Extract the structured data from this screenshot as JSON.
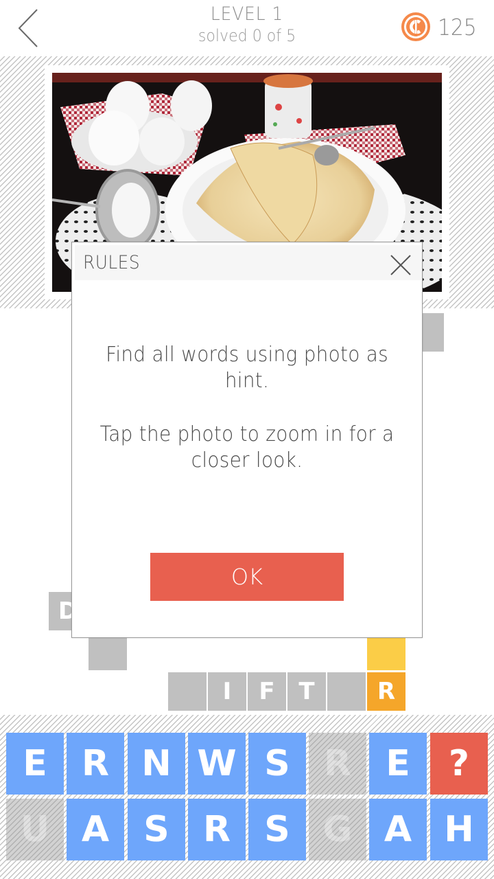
{
  "header": {
    "back_icon": "chevron-left-icon",
    "level_title": "LEVEL 1",
    "progress_text": "solved 0 of 5",
    "coin_icon": "coin-icon",
    "coin_count": "125",
    "colors": {
      "coin": "#f5894a",
      "text": "#8a8a8a"
    }
  },
  "photo": {
    "description": "Crepes on a white plate with fork and spoon, a bowl of eggs on a red checkered napkin, a sieve with powdered sugar, lace doilies, small floral cup"
  },
  "grid": {
    "cells": [
      {
        "id": "c1",
        "letter": "",
        "state": "empty"
      },
      {
        "id": "c2",
        "letter": "D",
        "state": "revealed"
      },
      {
        "id": "c3",
        "letter": "",
        "state": "empty"
      },
      {
        "id": "c4",
        "letter": "",
        "state": "highlight"
      },
      {
        "id": "c5",
        "letter": "",
        "state": "empty"
      },
      {
        "id": "c6",
        "letter": "I",
        "state": "revealed"
      },
      {
        "id": "c7",
        "letter": "F",
        "state": "revealed"
      },
      {
        "id": "c8",
        "letter": "T",
        "state": "revealed"
      },
      {
        "id": "c9",
        "letter": "",
        "state": "empty"
      },
      {
        "id": "c10",
        "letter": "R",
        "state": "active"
      }
    ],
    "colors": {
      "cell": "#c0c0c0",
      "highlight": "#fbcd47",
      "active": "#f5a62a"
    }
  },
  "keyboard": {
    "rows": [
      [
        {
          "letter": "E",
          "state": "available"
        },
        {
          "letter": "R",
          "state": "available"
        },
        {
          "letter": "N",
          "state": "available"
        },
        {
          "letter": "W",
          "state": "available"
        },
        {
          "letter": "S",
          "state": "available"
        },
        {
          "letter": "R",
          "state": "used"
        },
        {
          "letter": "E",
          "state": "available"
        },
        {
          "letter": "?",
          "state": "hint"
        }
      ],
      [
        {
          "letter": "U",
          "state": "used"
        },
        {
          "letter": "A",
          "state": "available"
        },
        {
          "letter": "S",
          "state": "available"
        },
        {
          "letter": "R",
          "state": "available"
        },
        {
          "letter": "S",
          "state": "available"
        },
        {
          "letter": "G",
          "state": "used"
        },
        {
          "letter": "A",
          "state": "available"
        },
        {
          "letter": "H",
          "state": "available"
        }
      ]
    ],
    "colors": {
      "available": "#6ea6fb",
      "used": "#d2d2d2",
      "hint": "#e8604f"
    }
  },
  "dialog": {
    "title": "RULES",
    "close_icon": "close-icon",
    "paragraphs": [
      "Find all words using photo as hint.",
      "Tap the photo to zoom in for a closer look."
    ],
    "ok_label": "OK",
    "colors": {
      "ok": "#e8604f",
      "header": "#f6f6f6"
    }
  }
}
